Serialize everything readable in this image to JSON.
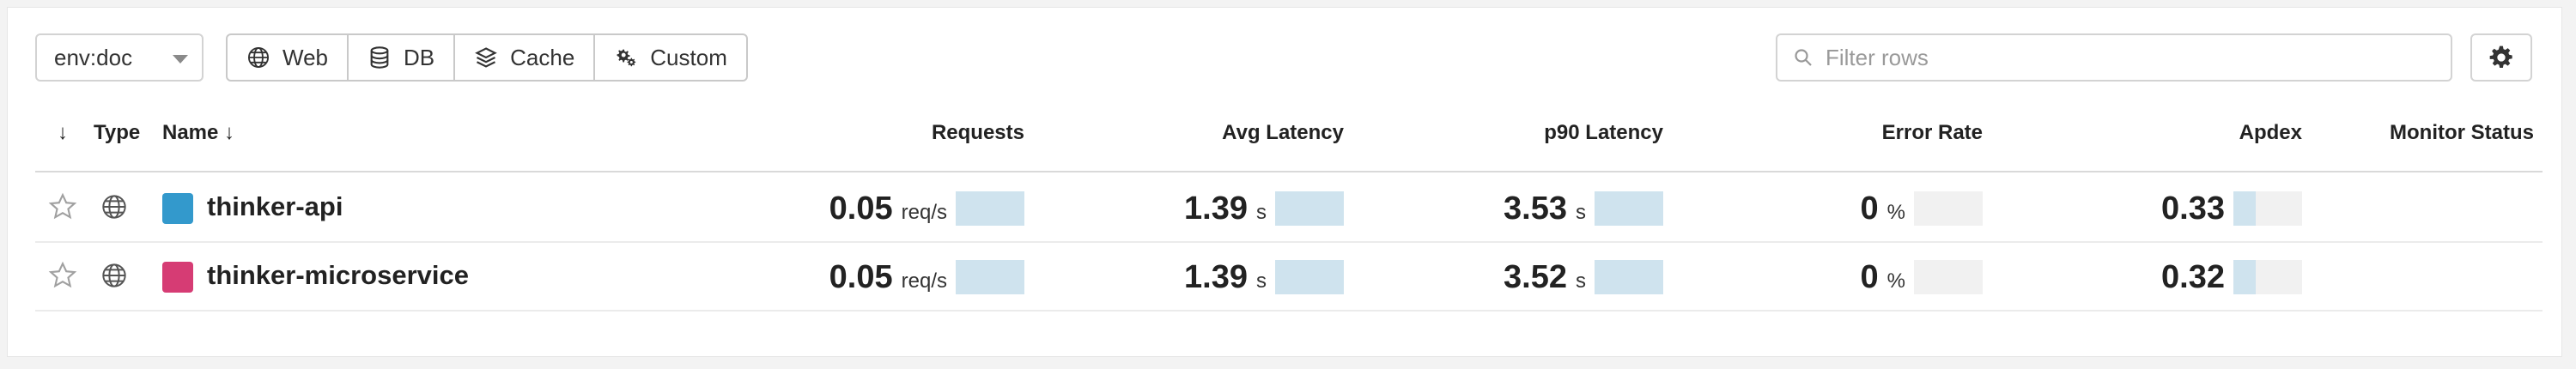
{
  "toolbar": {
    "env_value": "env:doc",
    "segments": [
      {
        "label": "Web",
        "icon": "globe-icon"
      },
      {
        "label": "DB",
        "icon": "database-icon"
      },
      {
        "label": "Cache",
        "icon": "layers-icon"
      },
      {
        "label": "Custom",
        "icon": "gears-icon"
      }
    ],
    "filter_placeholder": "Filter rows",
    "settings_icon": "gear-icon"
  },
  "table": {
    "headers": {
      "sort": "↓",
      "type": "Type",
      "name": "Name ↓",
      "requests": "Requests",
      "avg_latency": "Avg Latency",
      "p90_latency": "p90 Latency",
      "error_rate": "Error Rate",
      "apdex": "Apdex",
      "monitor_status": "Monitor Status"
    },
    "rows": [
      {
        "name": "thinker-api",
        "color": "#3399cc",
        "requests": {
          "value": "0.05",
          "unit": "req/s",
          "fill": 1.0
        },
        "avg_latency": {
          "value": "1.39",
          "unit": "s",
          "fill": 1.0
        },
        "p90_latency": {
          "value": "3.53",
          "unit": "s",
          "fill": 1.0
        },
        "error_rate": {
          "value": "0",
          "unit": "%",
          "fill": 0.0
        },
        "apdex": {
          "value": "0.33",
          "unit": "",
          "fill": 0.33
        },
        "monitor_status": ""
      },
      {
        "name": "thinker-microservice",
        "color": "#d63c74",
        "requests": {
          "value": "0.05",
          "unit": "req/s",
          "fill": 1.0
        },
        "avg_latency": {
          "value": "1.39",
          "unit": "s",
          "fill": 1.0
        },
        "p90_latency": {
          "value": "3.52",
          "unit": "s",
          "fill": 1.0
        },
        "error_rate": {
          "value": "0",
          "unit": "%",
          "fill": 0.0
        },
        "apdex": {
          "value": "0.32",
          "unit": "",
          "fill": 0.32
        },
        "monitor_status": ""
      }
    ]
  },
  "colors": {
    "bar_fill": "#cfe3ee",
    "bar_track": "#f1f1f1"
  }
}
